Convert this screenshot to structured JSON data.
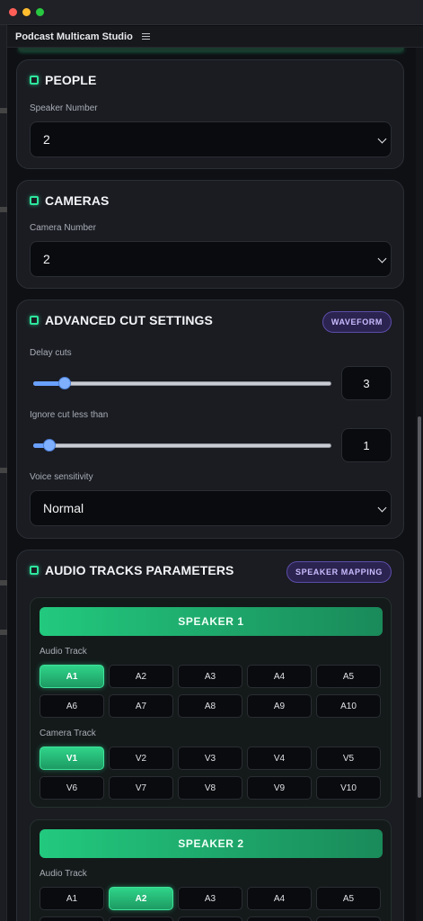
{
  "window": {
    "title": "Podcast Multicam Studio"
  },
  "people": {
    "title": "PEOPLE",
    "field_label": "Speaker Number",
    "value": "2"
  },
  "cameras": {
    "title": "CAMERAS",
    "field_label": "Camera Number",
    "value": "2"
  },
  "advanced": {
    "title": "ADVANCED CUT SETTINGS",
    "badge": "WAVEFORM",
    "delay_label": "Delay cuts",
    "delay_value": "3",
    "ignore_label": "Ignore cut less than",
    "ignore_value": "1",
    "voice_label": "Voice sensitivity",
    "voice_value": "Normal"
  },
  "audio": {
    "title": "AUDIO TRACKS PARAMETERS",
    "badge": "SPEAKER MAPPING",
    "audio_track_label": "Audio Track",
    "camera_track_label": "Camera Track",
    "audio_tracks": [
      "A1",
      "A2",
      "A3",
      "A4",
      "A5",
      "A6",
      "A7",
      "A8",
      "A9",
      "A10"
    ],
    "camera_tracks": [
      "V1",
      "V2",
      "V3",
      "V4",
      "V5",
      "V6",
      "V7",
      "V8",
      "V9",
      "V10"
    ],
    "speakers": [
      {
        "label": "SPEAKER 1",
        "audio_selected": "A1",
        "camera_selected": "V1"
      },
      {
        "label": "SPEAKER 2",
        "audio_selected": "A2"
      }
    ]
  },
  "colors": {
    "accent_green": "#2ee59d",
    "badge_purple": "#c9bcff",
    "slider_blue": "#7fb0ff"
  },
  "icons": {
    "section_marker": "square-outline-icon",
    "select_arrow": "chevron-down-icon",
    "menu": "hamburger-menu-icon"
  }
}
